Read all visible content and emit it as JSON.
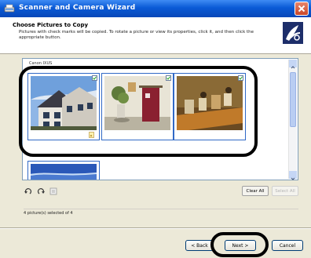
{
  "window": {
    "title": "Scanner and Camera Wizard"
  },
  "header": {
    "title": "Choose Pictures to Copy",
    "subtitle": "Pictures with check marks will be copied. To rotate a picture or view its properties, click it, and then click the appropriate button."
  },
  "list": {
    "label": "Canon IXUS",
    "thumbnails": [
      {
        "name": "house",
        "checked": true
      },
      {
        "name": "doorway",
        "checked": true
      },
      {
        "name": "shelf",
        "checked": true
      },
      {
        "name": "sky",
        "checked": true
      }
    ]
  },
  "tools": {
    "clear_all": "Clear All",
    "select_all": "Select All"
  },
  "status": {
    "text": "4 picture(s) selected of 4"
  },
  "nav": {
    "back": "< Back",
    "next": "Next >",
    "cancel": "Cancel"
  },
  "colors": {
    "titlebar": "#0a5ad6",
    "selection": "#3169c6",
    "highlight_ring": "#000000"
  }
}
